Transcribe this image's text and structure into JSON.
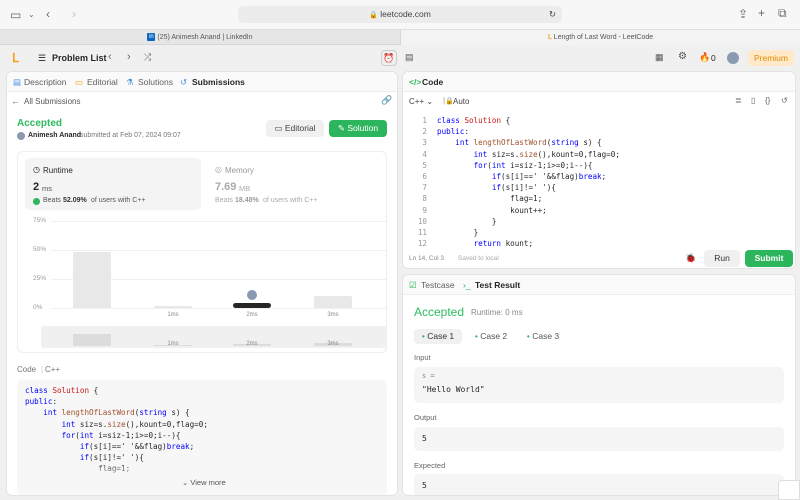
{
  "browser": {
    "url": "leetcode.com",
    "tabs": [
      {
        "label": "(25) Animesh Anand | LinkedIn",
        "icon": "linkedin-icon"
      },
      {
        "label": "Length of Last Word - LeetCode",
        "icon": "leetcode-icon"
      }
    ]
  },
  "nav": {
    "problem_list": "Problem List",
    "streak_count": "0",
    "premium": "Premium"
  },
  "left": {
    "tabs": [
      "Description",
      "Editorial",
      "Solutions",
      "Submissions"
    ],
    "back_label": "All Submissions",
    "status": "Accepted",
    "author": "Animesh Anand",
    "submitted_text": "submitted at Feb 07, 2024 09:07",
    "editorial_btn": "Editorial",
    "solution_btn": "Solution",
    "runtime": {
      "label": "Runtime",
      "value": "2",
      "unit": "ms",
      "beats_prefix": "Beats",
      "beats_value": "52.09%",
      "beats_suffix": "of users with C++"
    },
    "memory": {
      "label": "Memory",
      "value": "7.69",
      "unit": "MB",
      "beats_prefix": "Beats",
      "beats_value": "18.48%",
      "beats_suffix": "of users with C++"
    },
    "code_label": "Code",
    "lang": "C++",
    "code_lines": [
      "class Solution {",
      "public:",
      "    int lengthOfLastWord(string s) {",
      "        int siz=s.size(),kount=0,flag=0;",
      "        for(int i=siz-1;i>=0;i--){",
      "            if(s[i]==' '&&flag)break;",
      "            if(s[i]!=' '){",
      "                flag=1;"
    ],
    "view_more": "View more"
  },
  "chart_data": {
    "type": "bar",
    "y_ticks": [
      "75%",
      "50%",
      "25%",
      "0%"
    ],
    "ylim": [
      0,
      75
    ],
    "x_tick_labels": [
      "1ms",
      "2ms",
      "3ms"
    ],
    "bars": [
      {
        "x": "0ms",
        "value": 48
      },
      {
        "x": "1ms",
        "value": 2
      },
      {
        "x": "2ms",
        "value": 4,
        "highlight": true
      },
      {
        "x": "3ms",
        "value": 10
      }
    ]
  },
  "editor": {
    "title": "Code",
    "lang": "C++",
    "mode": "Auto",
    "lines": [
      "class Solution {",
      "public:",
      "    int lengthOfLastWord(string s) {",
      "        int siz=s.size(),kount=0,flag=0;",
      "        for(int i=siz-1;i>=0;i--){",
      "            if(s[i]==' '&&flag)break;",
      "            if(s[i]!=' '){",
      "                flag=1;",
      "                kount++;",
      "            }",
      "        }",
      "        return kount;"
    ],
    "line_numbers": [
      "1",
      "2",
      "3",
      "4",
      "5",
      "6",
      "7",
      "8",
      "9",
      "10",
      "11",
      "12"
    ],
    "position": "Ln 14, Col 3",
    "saved": "Saved to local",
    "run": "Run",
    "submit": "Submit"
  },
  "result": {
    "tab_testcase": "Testcase",
    "tab_result": "Test Result",
    "status": "Accepted",
    "runtime": "Runtime: 0 ms",
    "cases": [
      "Case 1",
      "Case 2",
      "Case 3"
    ],
    "input_label": "Input",
    "input_var": "s =",
    "input_value": "\"Hello World\"",
    "output_label": "Output",
    "output_value": "5",
    "expected_label": "Expected",
    "expected_value": "5"
  },
  "colors": {
    "accent_green": "#2db55d",
    "accepted_green": "#2cbb5d",
    "premium_orange": "#ffa116"
  }
}
